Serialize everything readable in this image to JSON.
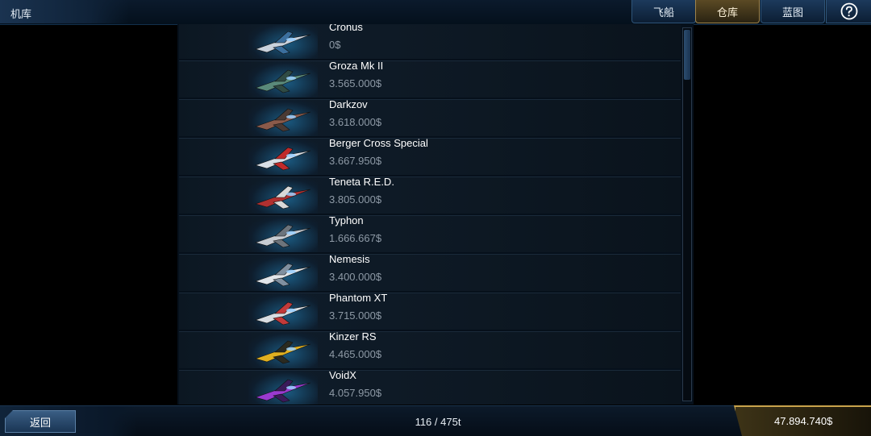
{
  "header": {
    "title": "机库",
    "tabs": [
      {
        "label": "飞船",
        "active": false
      },
      {
        "label": "仓库",
        "active": true
      },
      {
        "label": "蓝图",
        "active": false
      }
    ],
    "help_icon": "question-circle-icon"
  },
  "ships": [
    {
      "name": "Cronus",
      "price": "0$",
      "colors": [
        "#c9d2dc",
        "#3b6f9e"
      ]
    },
    {
      "name": "Groza Mk II",
      "price": "3.565.000$",
      "colors": [
        "#5a8a7a",
        "#2f4b44"
      ]
    },
    {
      "name": "Darkzov",
      "price": "3.618.000$",
      "colors": [
        "#8a5a4a",
        "#4a3a34"
      ]
    },
    {
      "name": "Berger Cross Special",
      "price": "3.667.950$",
      "colors": [
        "#d9dfe6",
        "#c02a2a"
      ]
    },
    {
      "name": "Teneta R.E.D.",
      "price": "3.805.000$",
      "colors": [
        "#b03030",
        "#d8d8d8"
      ]
    },
    {
      "name": "Typhon",
      "price": "1.666.667$",
      "colors": [
        "#c7ccd2",
        "#6c747c"
      ]
    },
    {
      "name": "Nemesis",
      "price": "3.400.000$",
      "colors": [
        "#e2e6ea",
        "#8090a0"
      ]
    },
    {
      "name": "Phantom XT",
      "price": "3.715.000$",
      "colors": [
        "#d8dde2",
        "#c23a3a"
      ]
    },
    {
      "name": "Kinzer RS",
      "price": "4.465.000$",
      "colors": [
        "#e0b020",
        "#2a2a20"
      ]
    },
    {
      "name": "VoidX",
      "price": "4.057.950$",
      "colors": [
        "#9a3ad0",
        "#3a1a5a"
      ]
    }
  ],
  "footer": {
    "back_label": "返回",
    "capacity": "116 / 475t",
    "money": "47.894.740$"
  },
  "scrollbar": {
    "position": 0.0
  }
}
